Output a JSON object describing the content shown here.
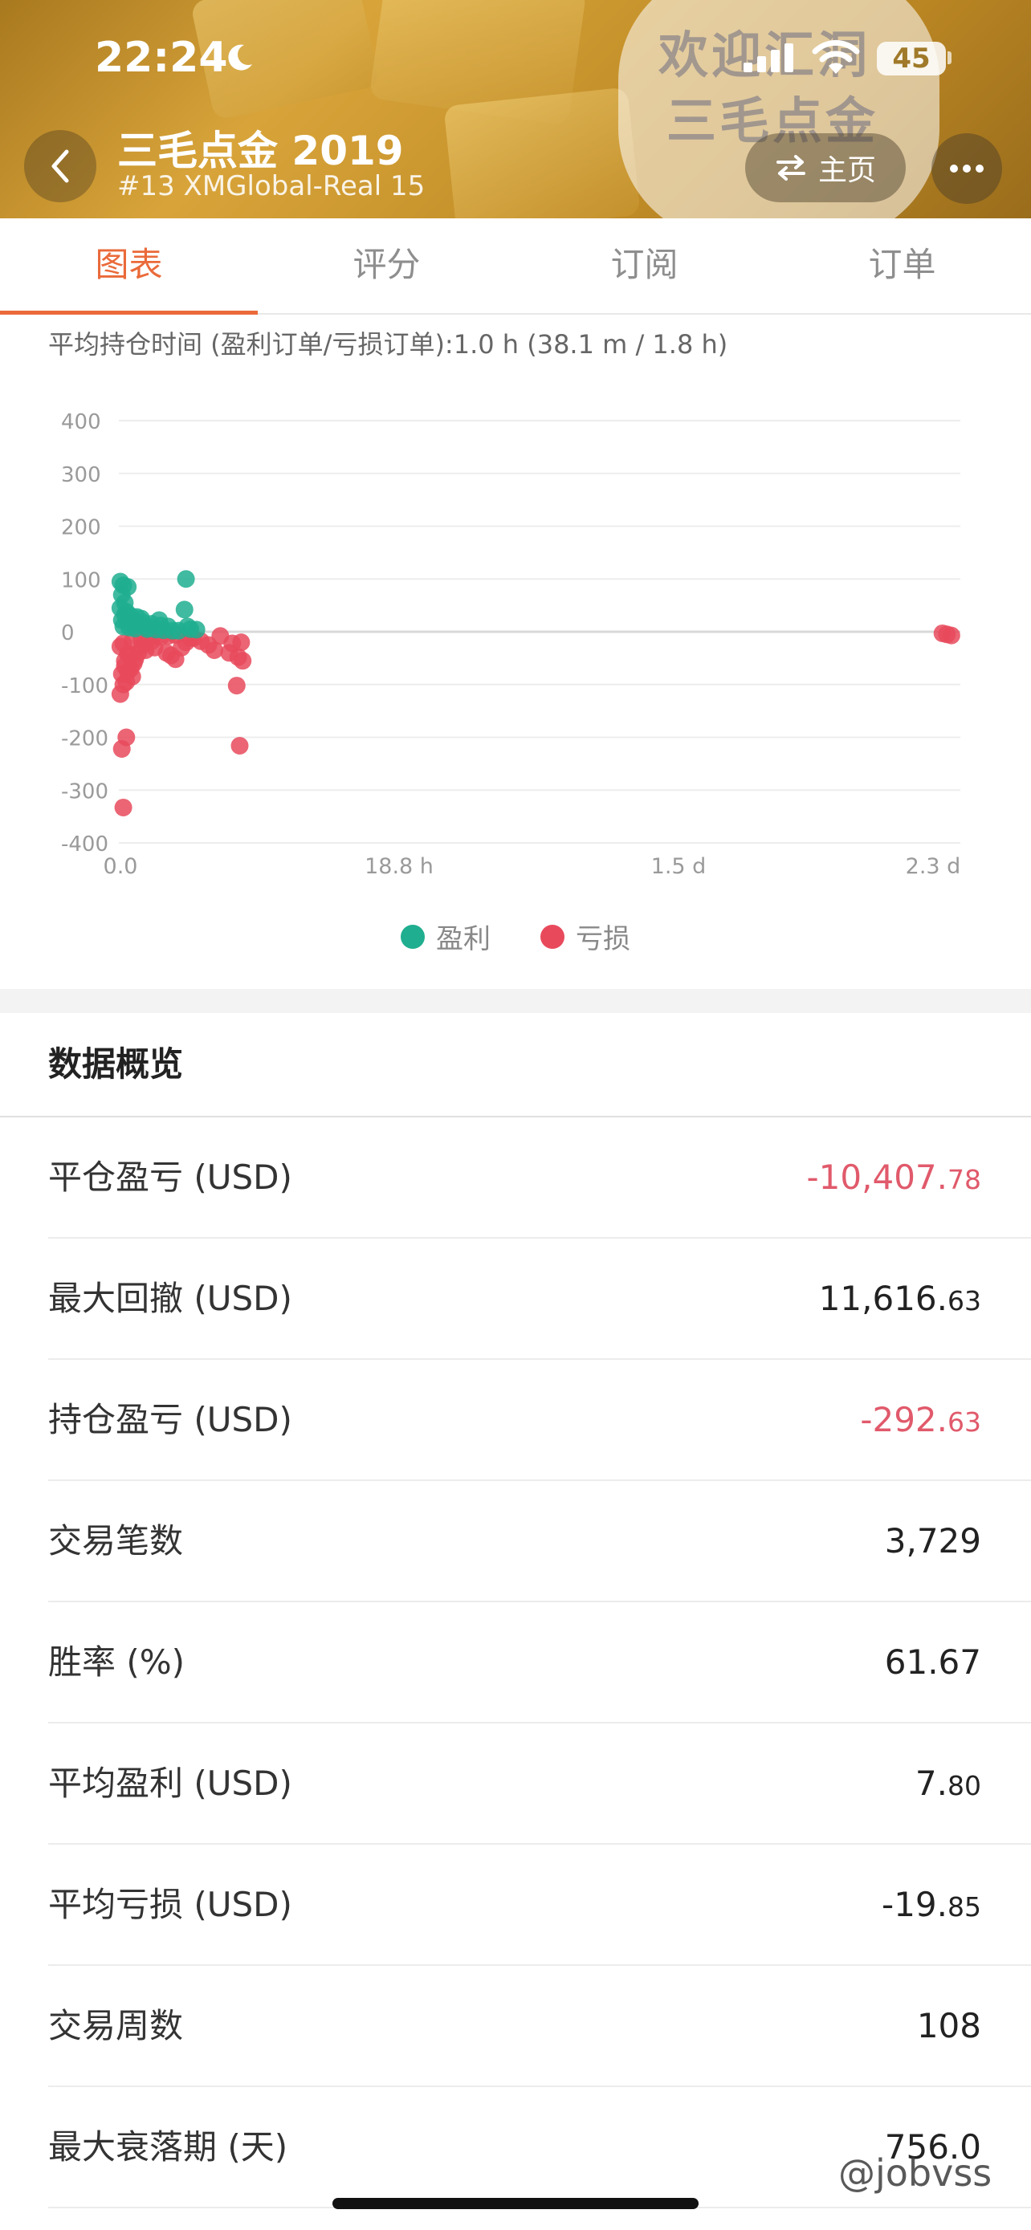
{
  "status_bar": {
    "time": "22:24",
    "battery": "45"
  },
  "header": {
    "title": "三毛点金 2019",
    "subtitle": "#13 XMGlobal-Real 15",
    "home_label": "主页",
    "watermark_line1": "欢迎汇洞",
    "watermark_line2": "三毛点金"
  },
  "tabs": [
    {
      "label": "图表",
      "active": true
    },
    {
      "label": "评分",
      "active": false
    },
    {
      "label": "订阅",
      "active": false
    },
    {
      "label": "订单",
      "active": false
    }
  ],
  "chart_caption": "平均持仓时间 (盈利订单/亏损订单):1.0 h (38.1 m / 1.8 h)",
  "chart_data": {
    "type": "scatter",
    "title": "",
    "xlabel": "",
    "ylabel": "",
    "y_ticks": [
      "400",
      "300",
      "200",
      "100",
      "0",
      "-100",
      "-200",
      "-300",
      "-400"
    ],
    "x_ticks": [
      "0.0",
      "18.8 h",
      "1.5 d",
      "2.3 d"
    ],
    "ylim": [
      -400,
      400
    ],
    "xlim_hours": [
      0,
      56.4
    ],
    "legend_position": "bottom",
    "series": [
      {
        "name": "盈利",
        "color": "#1fae8f",
        "points": [
          [
            0.1,
            95
          ],
          [
            0.3,
            88
          ],
          [
            0.6,
            85
          ],
          [
            0.2,
            70
          ],
          [
            0.4,
            55
          ],
          [
            0.1,
            45
          ],
          [
            0.5,
            38
          ],
          [
            0.8,
            30
          ],
          [
            1.2,
            28
          ],
          [
            1.5,
            25
          ],
          [
            0.9,
            20
          ],
          [
            1.6,
            18
          ],
          [
            2.2,
            15
          ],
          [
            2.8,
            12
          ],
          [
            3.3,
            10
          ],
          [
            0.3,
            10
          ],
          [
            0.7,
            8
          ],
          [
            1.1,
            6
          ],
          [
            1.9,
            5
          ],
          [
            2.5,
            4
          ],
          [
            3.0,
            3
          ],
          [
            3.6,
            2
          ],
          [
            4.0,
            2
          ],
          [
            0.2,
            22
          ],
          [
            0.6,
            18
          ],
          [
            1.3,
            12
          ],
          [
            2.0,
            8
          ],
          [
            4.8,
            5
          ],
          [
            5.2,
            4
          ],
          [
            4.5,
            100
          ],
          [
            4.4,
            42
          ],
          [
            4.6,
            10
          ],
          [
            0.4,
            32
          ],
          [
            1.0,
            14
          ],
          [
            2.7,
            22
          ]
        ]
      },
      {
        "name": "亏损",
        "color": "#e84a5c",
        "points": [
          [
            0.1,
            -118
          ],
          [
            0.3,
            -100
          ],
          [
            0.5,
            -95
          ],
          [
            0.2,
            -80
          ],
          [
            0.6,
            -75
          ],
          [
            0.8,
            -70
          ],
          [
            1.0,
            -60
          ],
          [
            0.4,
            -55
          ],
          [
            0.7,
            -45
          ],
          [
            1.3,
            -40
          ],
          [
            1.8,
            -35
          ],
          [
            2.4,
            -30
          ],
          [
            0.1,
            -28
          ],
          [
            0.3,
            -22
          ],
          [
            0.9,
            -18
          ],
          [
            1.5,
            -15
          ],
          [
            2.0,
            -12
          ],
          [
            2.8,
            -10
          ],
          [
            3.3,
            -8
          ],
          [
            3.8,
            -6
          ],
          [
            0.2,
            -222
          ],
          [
            0.5,
            -200
          ],
          [
            0.3,
            -333
          ],
          [
            3.5,
            -45
          ],
          [
            3.8,
            -52
          ],
          [
            3.2,
            -40
          ],
          [
            4.5,
            -20
          ],
          [
            5.0,
            -12
          ],
          [
            5.5,
            -18
          ],
          [
            6.0,
            -25
          ],
          [
            6.4,
            -35
          ],
          [
            6.8,
            -8
          ],
          [
            7.6,
            -22
          ],
          [
            7.4,
            -40
          ],
          [
            8.0,
            -48
          ],
          [
            8.3,
            -55
          ],
          [
            7.9,
            -102
          ],
          [
            8.1,
            -216
          ],
          [
            8.2,
            -20
          ],
          [
            0.6,
            -42
          ],
          [
            1.1,
            -52
          ],
          [
            0.4,
            -65
          ],
          [
            55.2,
            -3
          ],
          [
            55.5,
            -5
          ],
          [
            55.8,
            -7
          ],
          [
            1.6,
            -25
          ],
          [
            2.2,
            -18
          ],
          [
            4.2,
            -30
          ],
          [
            4.8,
            -12
          ],
          [
            0.9,
            -85
          ]
        ]
      }
    ]
  },
  "overview": {
    "title": "数据概览",
    "rows": [
      {
        "label": "平仓盈亏 (USD)",
        "int": "-10,407.",
        "dec": "78",
        "negative": true
      },
      {
        "label": "最大回撤 (USD)",
        "int": "11,616.",
        "dec": "63",
        "negative": false
      },
      {
        "label": "持仓盈亏 (USD)",
        "int": "-292.",
        "dec": "63",
        "negative": true
      },
      {
        "label": "交易笔数",
        "int": "3,729",
        "dec": "",
        "negative": false
      },
      {
        "label": "胜率 (%)",
        "int": "61.67",
        "dec": "",
        "negative": false
      },
      {
        "label": "平均盈利 (USD)",
        "int": "7.",
        "dec": "80",
        "negative": false
      },
      {
        "label": "平均亏损 (USD)",
        "int": "-19.",
        "dec": "85",
        "negative": false
      },
      {
        "label": "交易周数",
        "int": "108",
        "dec": "",
        "negative": false
      },
      {
        "label": "最大衰落期 (天)",
        "int": "756.0",
        "dec": "",
        "negative": false
      }
    ]
  },
  "corner_watermark": "@jobvss"
}
